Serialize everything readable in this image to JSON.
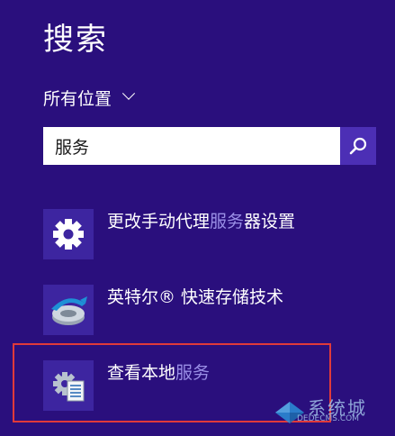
{
  "search": {
    "title": "搜索",
    "scope": "所有位置",
    "query": "服务"
  },
  "results": [
    {
      "prefix": "更改手动代理",
      "highlight": "服务",
      "suffix": "器设置",
      "icon": "gear-icon"
    },
    {
      "prefix": "英特尔® 快速存储技术",
      "highlight": "",
      "suffix": "",
      "icon": "intel-rst-icon"
    },
    {
      "prefix": "查看本地",
      "highlight": "服务",
      "suffix": "",
      "icon": "services-icon"
    }
  ],
  "watermark": {
    "text": "系统城",
    "url": "DEDECMS.COM"
  },
  "colors": {
    "background": "#2a0f7d",
    "search_button": "#4c2fb5",
    "tile": "#3d25a0",
    "highlight": "#9a8fe6",
    "selection_border": "#e03a3a"
  }
}
